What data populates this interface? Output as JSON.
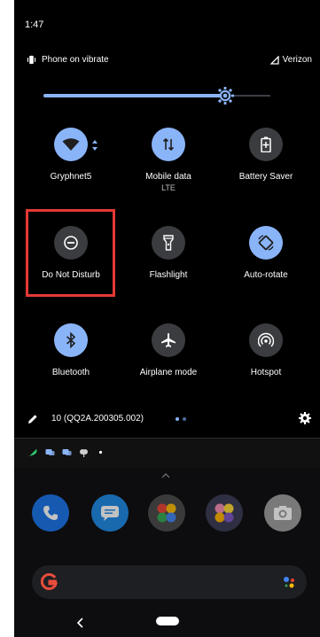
{
  "status": {
    "time": "1:47",
    "ringer": "Phone on vibrate",
    "carrier": "Verizon"
  },
  "brightness": {
    "level_percent": 80
  },
  "tiles": [
    {
      "label": "Gryphnet5",
      "sub": "",
      "state": "on",
      "icon": "wifi-icon"
    },
    {
      "label": "Mobile data",
      "sub": "LTE",
      "state": "on",
      "icon": "mobile-data-icon"
    },
    {
      "label": "Battery Saver",
      "sub": "",
      "state": "off",
      "icon": "battery-saver-icon"
    },
    {
      "label": "Do Not Disturb",
      "sub": "",
      "state": "off",
      "icon": "do-not-disturb-icon"
    },
    {
      "label": "Flashlight",
      "sub": "",
      "state": "off",
      "icon": "flashlight-icon"
    },
    {
      "label": "Auto-rotate",
      "sub": "",
      "state": "on",
      "icon": "auto-rotate-icon"
    },
    {
      "label": "Bluetooth",
      "sub": "",
      "state": "on",
      "icon": "bluetooth-icon"
    },
    {
      "label": "Airplane mode",
      "sub": "",
      "state": "off",
      "icon": "airplane-icon"
    },
    {
      "label": "Hotspot",
      "sub": "",
      "state": "off",
      "icon": "hotspot-icon"
    }
  ],
  "footer": {
    "build": "10 (QQ2A.200305.002)",
    "page_count": 2,
    "current_page": 1
  },
  "colors": {
    "accent": "#8ab4f8",
    "tile_off": "#3a3c3f",
    "highlight": "#e53935",
    "background": "#000000"
  },
  "dock_apps": [
    "phone-icon",
    "messages-icon",
    "google-apps-icon",
    "apps-folder-icon",
    "camera-icon"
  ]
}
